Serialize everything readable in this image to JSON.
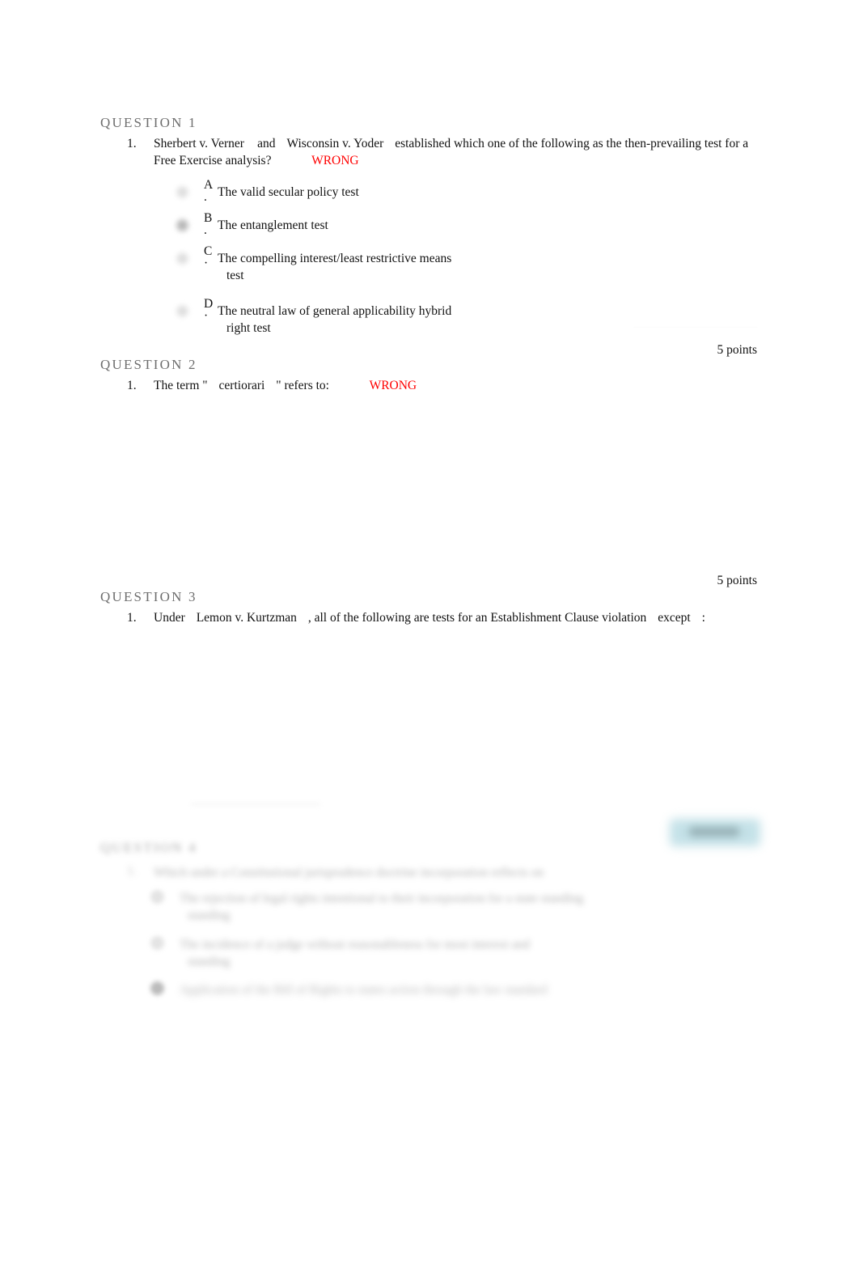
{
  "document": {
    "background_color": "#ffffff",
    "heading_color": "#6e6e6e",
    "text_color": "#111111",
    "wrong_color": "#ff0000",
    "button_color": "#bfdfe6"
  },
  "questions": [
    {
      "heading": "QUESTION 1",
      "number": "1.",
      "prompt_lead": "Sherbert v. Verner",
      "prompt_conj": "and",
      "prompt_case2": "Wisconsin v. Yoder",
      "prompt_rest": "established which one of the following as the then-prevailing test for a Free Exercise analysis?",
      "status": "WRONG",
      "options": [
        {
          "letter": "A",
          "dot": ".",
          "text": "The valid secular policy test",
          "continuation": "",
          "selected": false
        },
        {
          "letter": "B",
          "dot": ".",
          "text": "The entanglement test",
          "continuation": "",
          "selected": true
        },
        {
          "letter": "C",
          "dot": "·",
          "text": "The compelling interest/least restrictive means",
          "continuation": "test",
          "selected": false
        },
        {
          "letter": "D",
          "dot": "·",
          "text": "The neutral law of general applicability hybrid",
          "continuation": "right test",
          "selected": false
        }
      ],
      "points": "5 points"
    },
    {
      "heading": "QUESTION 2",
      "number": "1.",
      "prompt_prefix": "The term \"",
      "prompt_term": "certiorari",
      "prompt_suffix": "\" refers to:",
      "status": "WRONG",
      "options": [],
      "points": "5 points"
    },
    {
      "heading": "QUESTION 3",
      "number": "1.",
      "prompt_prefix": "Under",
      "prompt_case": "Lemon v. Kurtzman",
      "prompt_mid": ", all of the following are tests for an Establishment Clause violation",
      "prompt_except": "except",
      "prompt_colon": ":",
      "options": [],
      "points": ""
    }
  ],
  "blurred_section": {
    "heading": "QUESTION 4",
    "number": "1.",
    "prompt": "Which under a Constitutional jurisprudence doctrine incorporation reflects on",
    "options": [
      {
        "text": "The rejection of legal rights intentional to their incorporation for a state standing",
        "continuation": "standing",
        "selected": false
      },
      {
        "text": "The incidence of a judge without reasonableness for most interest and",
        "continuation": "standing",
        "selected": false
      },
      {
        "text": "Application of the Bill of Rights to states action through the law standard",
        "continuation": "",
        "selected": true
      }
    ],
    "button_label": "Continue"
  }
}
